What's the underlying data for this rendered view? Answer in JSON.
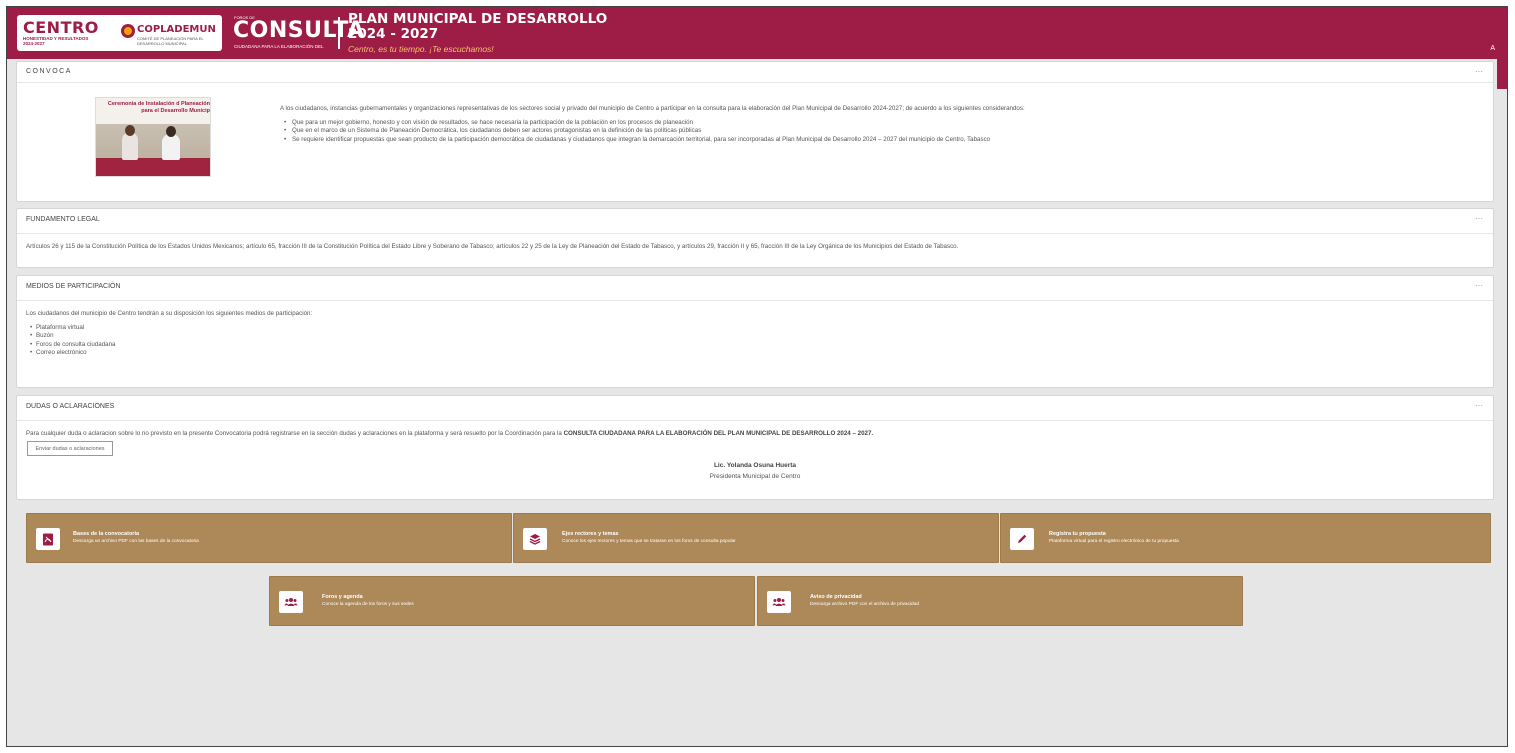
{
  "header": {
    "centro_logo": "CENTRO",
    "centro_sub": "HONESTIDAD Y RESULTADOS 2024-2027",
    "coplademun_logo": "COPLADEMUN",
    "coplademun_sub": "COMITÉ DE PLANEACIÓN PARA EL DESARROLLO MUNICIPAL",
    "foros_small": "FOROS DE",
    "consulta": "CONSULTA",
    "consulta_sub": "CIUDADANA PARA LA ELABORACIÓN DEL",
    "plan_title": "PLAN MUNICIPAL DE DESARROLLO 2024 - 2027",
    "slogan": "Centro, es tu tiempo. ¡Te escuchamos!",
    "accessibility_label": "A",
    "bg_color": "#9e1d47",
    "accent_color": "#f6c36a"
  },
  "convoca": {
    "title": "CONVOCA",
    "menu": "···",
    "image_caption": "Ceremonia de Instalación d Planeación para el Desarrollo Municip",
    "intro": "A los ciudadanos, instancias gubernamentales y organizaciones representativas de los sectores social y privado del municipio de Centro a participar en la consulta para la elaboración del Plan Municipal de Desarrollo 2024-2027; de acuerdo a los siguientes considerandos:",
    "items": [
      "Que para un mejor gobierno, honesto y con visión de resultados, se hace necesaria la participación de la población en los procesos de planeación",
      "Que en el marco de un Sistema de Planeación Democrática, los ciudadanos deben ser actores protagonistas en la definición de las políticas públicas",
      "Se requiere identificar propuestas que sean producto de la participación democrática de ciudadanas y ciudadanos que integran la demarcación territorial, para ser incorporadas al Plan Municipal de Desarrollo 2024 – 2027 del municipio de Centro, Tabasco"
    ]
  },
  "fundamento": {
    "title": "FUNDAMENTO LEGAL",
    "menu": "···",
    "text": "Artículos 26 y 115 de la Constitución Política de los Estados Unidos Mexicanos; artículo 65, fracción III de la Constitución Política del Estado Libre y Soberano de Tabasco; artículos 22 y 25 de la Ley de Planeación del Estado de Tabasco, y artículos 29, fracción II y 65, fracción III de la Ley Orgánica de los Municipios del Estado de Tabasco."
  },
  "medios": {
    "title": "MEDIOS DE PARTICIPACIÓN",
    "menu": "···",
    "intro": "Los ciudadanos del municipio de Centro tendrán a su disposición los siguientes medios de participación:",
    "items": [
      "Plataforma virtual",
      "Buzón",
      "Foros de consulta ciudadana",
      "Correo electrónico"
    ]
  },
  "dudas": {
    "title": "DUDAS O ACLARACIONES",
    "menu": "···",
    "text_before": "Para cualquier duda o aclaracion sobre lo no previsto en la presente Convocatoria podrá registrarse en la sección dudas y aclaraciones en la plataforma y será resuelto por la Coordinación para la ",
    "text_bold": "CONSULTA CIUDADANA PARA LA ELABORACIÓN DEL PLAN MUNICIPAL DE DESARROLLO 2024 – 2027.",
    "button_label": "Enviar dudas o aclaraciones",
    "signer_name": "Lic. Yolanda Osuna Huerta",
    "signer_role": "Presidenta Municipal de Centro"
  },
  "tiles": [
    {
      "icon": "pdf-icon",
      "title": "Bases de la convocatoria",
      "subtitle": "Descarga un archivo PDF con las bases de la convocatoria"
    },
    {
      "icon": "layers-icon",
      "title": "Ejes rectores y temas",
      "subtitle": "Conoce los ejes rectores y temas que se trataran en los foros de consulta popular"
    },
    {
      "icon": "pencil-icon",
      "title": "Registra tu propuesta",
      "subtitle": "Plataforma virtual para el registro electrónico de tu propuesta"
    },
    {
      "icon": "users-icon",
      "title": "Foros y agenda",
      "subtitle": "Conoce la agenda de los foros y sus sedes"
    },
    {
      "icon": "users-icon",
      "title": "Aviso de privacidad",
      "subtitle": "Descarga archivo PDF con el archivo de privacidad"
    }
  ],
  "tile_color": "#ad8858"
}
